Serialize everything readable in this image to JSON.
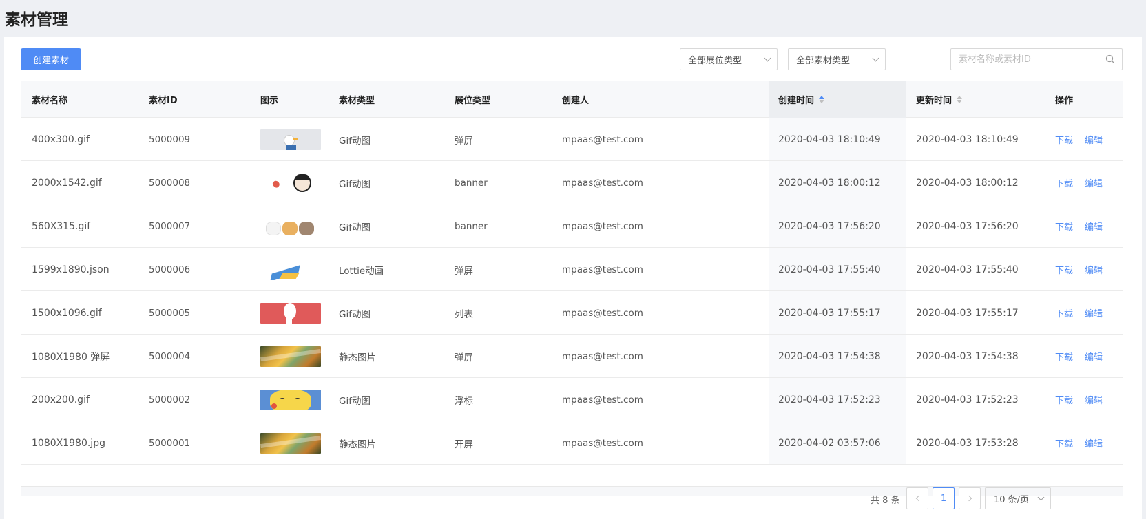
{
  "page_title": "素材管理",
  "toolbar": {
    "create_label": "创建素材",
    "slot_filter": "全部展位类型",
    "material_filter": "全部素材类型",
    "search_placeholder": "素材名称或素材ID"
  },
  "table": {
    "headers": {
      "name": "素材名称",
      "id": "素材ID",
      "preview": "图示",
      "material_type": "素材类型",
      "slot_type": "展位类型",
      "creator": "创建人",
      "created": "创建时间",
      "updated": "更新时间",
      "actions": "操作"
    },
    "action_labels": {
      "download": "下载",
      "edit": "编辑"
    },
    "rows": [
      {
        "name": "400x300.gif",
        "id": "5000009",
        "thumb": "bird",
        "material_type": "Gif动图",
        "slot_type": "弹屏",
        "creator": "mpaas@test.com",
        "created": "2020-04-03 18:10:49",
        "updated": "2020-04-03 18:10:49"
      },
      {
        "name": "2000x1542.gif",
        "id": "5000008",
        "thumb": "cartoon",
        "material_type": "Gif动图",
        "slot_type": "banner",
        "creator": "mpaas@test.com",
        "created": "2020-04-03 18:00:12",
        "updated": "2020-04-03 18:00:12"
      },
      {
        "name": "560X315.gif",
        "id": "5000007",
        "thumb": "cats",
        "material_type": "Gif动图",
        "slot_type": "banner",
        "creator": "mpaas@test.com",
        "created": "2020-04-03 17:56:20",
        "updated": "2020-04-03 17:56:20"
      },
      {
        "name": "1599x1890.json",
        "id": "5000006",
        "thumb": "lottie",
        "material_type": "Lottie动画",
        "slot_type": "弹屏",
        "creator": "mpaas@test.com",
        "created": "2020-04-03 17:55:40",
        "updated": "2020-04-03 17:55:40"
      },
      {
        "name": "1500x1096.gif",
        "id": "5000005",
        "thumb": "red",
        "material_type": "Gif动图",
        "slot_type": "列表",
        "creator": "mpaas@test.com",
        "created": "2020-04-03 17:55:17",
        "updated": "2020-04-03 17:55:17"
      },
      {
        "name": "1080X1980 弹屏",
        "id": "5000004",
        "thumb": "landscape",
        "material_type": "静态图片",
        "slot_type": "弹屏",
        "creator": "mpaas@test.com",
        "created": "2020-04-03 17:54:38",
        "updated": "2020-04-03 17:54:38"
      },
      {
        "name": "200x200.gif",
        "id": "5000002",
        "thumb": "pikachu",
        "material_type": "Gif动图",
        "slot_type": "浮标",
        "creator": "mpaas@test.com",
        "created": "2020-04-03 17:52:23",
        "updated": "2020-04-03 17:52:23"
      },
      {
        "name": "1080X1980.jpg",
        "id": "5000001",
        "thumb": "landscape",
        "material_type": "静态图片",
        "slot_type": "开屏",
        "creator": "mpaas@test.com",
        "created": "2020-04-02 03:57:06",
        "updated": "2020-04-03 17:53:28"
      }
    ]
  },
  "pagination": {
    "total_label": "共 8 条",
    "current_page": "1",
    "page_size_label": "10 条/页"
  },
  "colors": {
    "primary": "#4f8bf5",
    "background": "#eef0f4"
  }
}
